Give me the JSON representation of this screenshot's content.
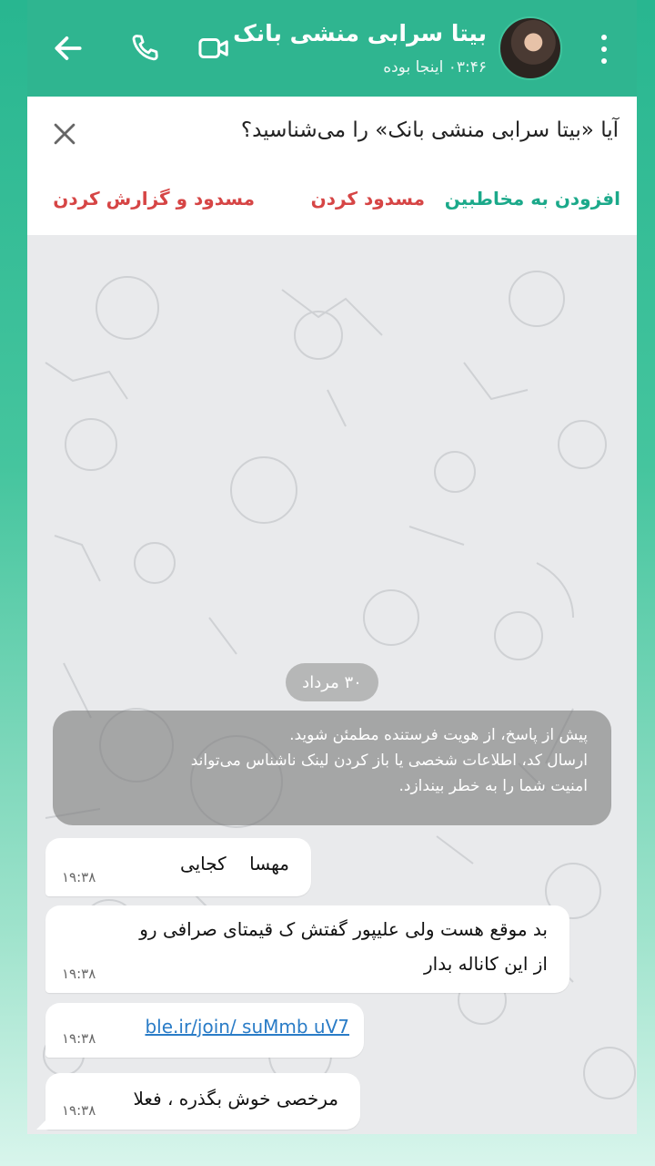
{
  "header": {
    "title": "بیتا سرابی منشی بانک",
    "status": "۰۳:۴۶ اینجا بوده",
    "back_icon": "arrow-left-icon",
    "call_icon": "phone-icon",
    "video_icon": "video-camera-icon",
    "menu_icon": "kebab-menu-icon"
  },
  "banner": {
    "question": "آیا «بیتا سرابی منشی بانک» را می‌شناسید؟",
    "add_contact": "افزودن به مخاطبین",
    "block": "مسدود کردن",
    "block_report": "مسدود و گزارش کردن"
  },
  "chat": {
    "date": "۳۰ مرداد",
    "warning": [
      "پیش از پاسخ، از هویت فرستنده مطمئن شوید.",
      "ارسال کد، اطلاعات شخصی یا باز کردن لینک ناشناس می‌تواند",
      "امنیت شما را به خطر بیندازد."
    ],
    "messages": [
      {
        "text": "مهسا ‌‌‌‌‌‌‌‌‌ ‌‌ ‌ کجایی",
        "time": "۱۹:۳۸"
      },
      {
        "line1": "بد موقع هست ولی  علیپور گفتش ک قیمتای صرافی رو",
        "line2": "از این کاناله بدار",
        "time": "۱۹:۳۸"
      },
      {
        "link": "ble.ir/join/  suMmb  uV7",
        "time": "۱۹:۳۸"
      },
      {
        "text": "مرخصی خوش بگذره ، فعلا",
        "time": "۱۹:۳۸"
      }
    ]
  },
  "colors": {
    "header_bg": "#2fb590",
    "green_action": "#1ba98a",
    "red_action": "#d64545",
    "link": "#2a7cc7"
  }
}
